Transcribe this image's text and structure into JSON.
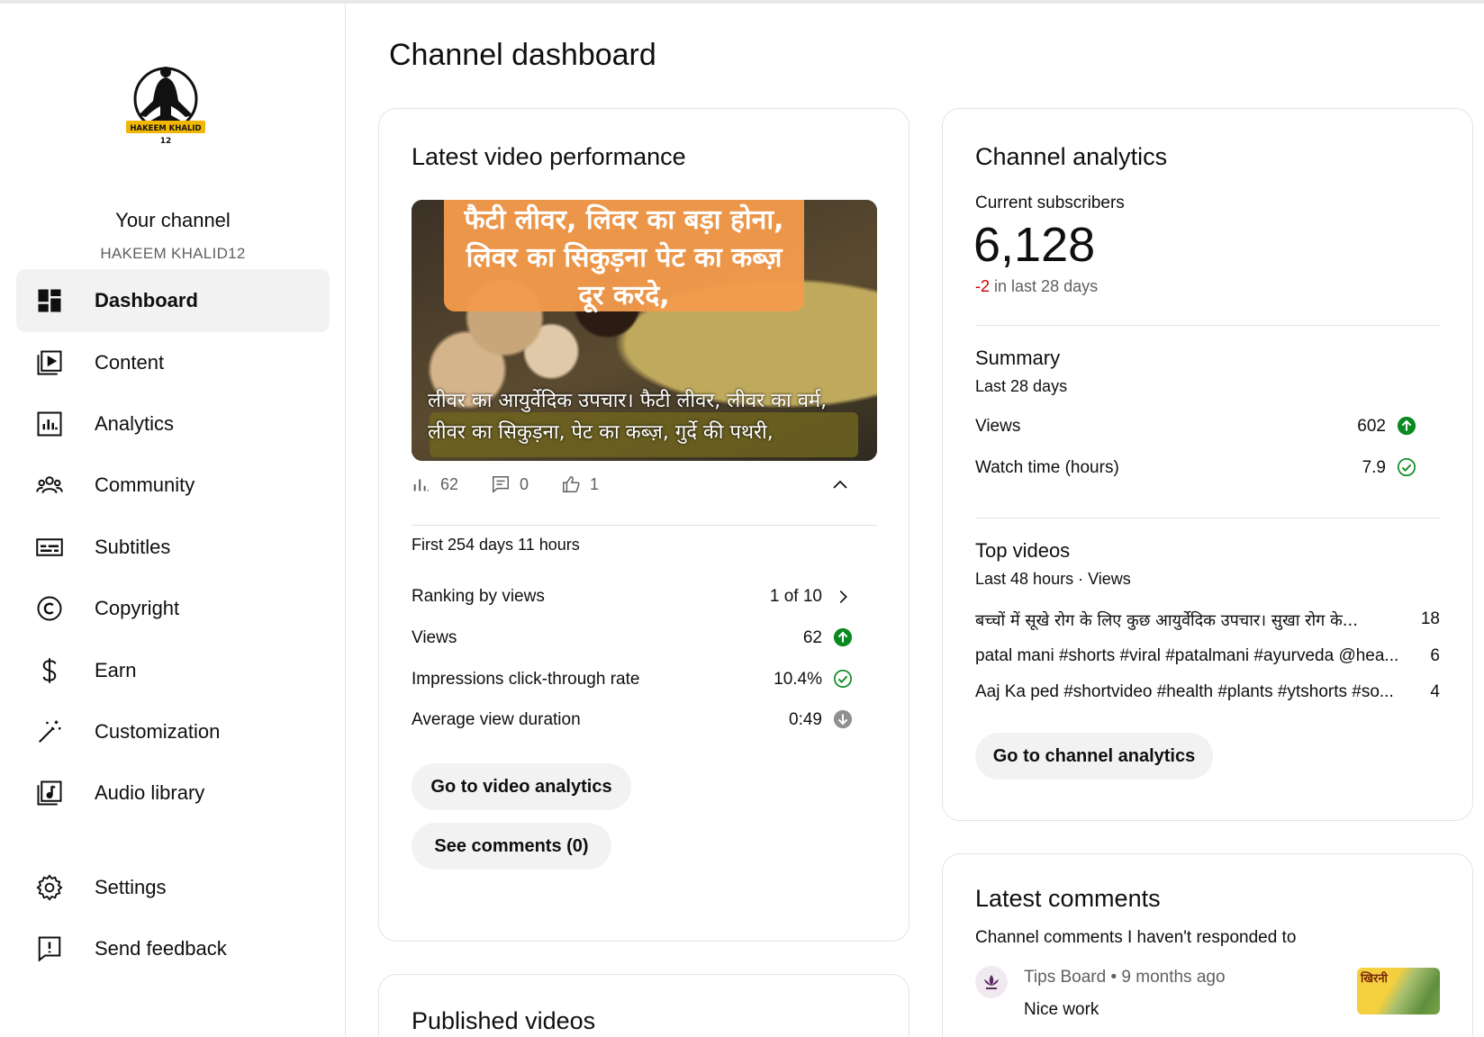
{
  "sidebar": {
    "channel_label": "Your channel",
    "channel_handle": "HAKEEM KHALID12",
    "avatar_text_top": "HAKEEM KHALID",
    "avatar_text_bottom": "12",
    "items": [
      {
        "label": "Dashboard",
        "icon": "dashboard-icon",
        "active": true
      },
      {
        "label": "Content",
        "icon": "content-icon"
      },
      {
        "label": "Analytics",
        "icon": "analytics-icon"
      },
      {
        "label": "Community",
        "icon": "community-icon"
      },
      {
        "label": "Subtitles",
        "icon": "subtitles-icon"
      },
      {
        "label": "Copyright",
        "icon": "copyright-icon"
      },
      {
        "label": "Earn",
        "icon": "earn-icon"
      },
      {
        "label": "Customization",
        "icon": "customization-icon"
      },
      {
        "label": "Audio library",
        "icon": "audio-library-icon"
      }
    ],
    "footer_items": [
      {
        "label": "Settings",
        "icon": "gear-icon"
      },
      {
        "label": "Send feedback",
        "icon": "feedback-icon"
      }
    ]
  },
  "page": {
    "title": "Channel dashboard"
  },
  "latest_video": {
    "title": "Latest video performance",
    "thumbnail_top_text": "फैटी लीवर, लिवर का बड़ा होना, लिवर का सिकुड़ना पेट का कब्ज़ दूर करदे,",
    "thumbnail_bottom_text": "लीवर का आयुर्वेदिक उपचार। फैटी लीवर, लीवर का वर्म, लीवर का सिकुड़ना, पेट का कब्ज़, गुर्दे की पथरी,",
    "stats": {
      "views": "62",
      "comments": "0",
      "likes": "1"
    },
    "period": "First 254 days 11 hours",
    "metrics": [
      {
        "label": "Ranking by views",
        "value": "1 of 10",
        "indicator": "chevron-right"
      },
      {
        "label": "Views",
        "value": "62",
        "indicator": "up"
      },
      {
        "label": "Impressions click-through rate",
        "value": "10.4%",
        "indicator": "check"
      },
      {
        "label": "Average view duration",
        "value": "0:49",
        "indicator": "down"
      }
    ],
    "buttons": {
      "analytics": "Go to video analytics",
      "comments": "See comments (0)"
    }
  },
  "published_videos": {
    "title": "Published videos"
  },
  "channel_analytics": {
    "title": "Channel analytics",
    "subscribers_label": "Current subscribers",
    "subscribers": "6,128",
    "change_value": "-2",
    "change_label": "in last 28 days",
    "summary_title": "Summary",
    "summary_period": "Last 28 days",
    "summary": [
      {
        "label": "Views",
        "value": "602",
        "indicator": "up"
      },
      {
        "label": "Watch time (hours)",
        "value": "7.9",
        "indicator": "check"
      }
    ],
    "top_title": "Top videos",
    "top_period": "Last 48 hours · Views",
    "top_videos": [
      {
        "title": "बच्चों में सूखे रोग के लिए कुछ आयुर्वेदिक उपचार। सुखा रोग के...",
        "views": "18"
      },
      {
        "title": "patal mani #shorts #viral #patalmani #ayurveda @hea...",
        "views": "6"
      },
      {
        "title": "Aaj Ka ped #shortvideo #health #plants #ytshorts #so...",
        "views": "4"
      }
    ],
    "button": "Go to channel analytics"
  },
  "latest_comments": {
    "title": "Latest comments",
    "subtitle": "Channel comments I haven't responded to",
    "comment": {
      "author": "Tips Board",
      "time": "9 months ago",
      "text": "Nice work",
      "thumb_text": "खिरनी"
    }
  },
  "colors": {
    "green": "#0a8a1f",
    "red": "#cc0000",
    "grey_icon": "#909090",
    "pill_bg": "#f2f2f2"
  }
}
